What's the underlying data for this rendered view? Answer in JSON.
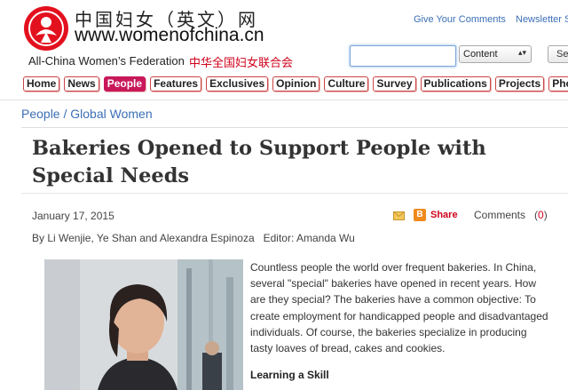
{
  "header": {
    "site_name_cn": "中国妇女（英文）网",
    "site_url": "www.womenofchina.cn",
    "federation_en": "All-China Women’s Federation",
    "federation_cn": "中华全国妇女联合会",
    "links": [
      "Give Your Comments",
      "Newsletter S"
    ]
  },
  "search": {
    "input_value": "",
    "select_value": "Content",
    "button_label": "Se"
  },
  "nav": {
    "items": [
      "Home",
      "News",
      "People",
      "Features",
      "Exclusives",
      "Opinion",
      "Culture",
      "Survey",
      "Publications",
      "Projects",
      "Pho"
    ],
    "active": "People"
  },
  "breadcrumb": "People / Global Women",
  "article": {
    "title": "Bakeries Opened to Support People with Special Needs",
    "date": "January 17, 2015",
    "share_label": "Share",
    "share_icon_glyph": "B",
    "comments_label": "Comments",
    "comments_open": "(",
    "comments_count": "0",
    "comments_close": ")",
    "byline": "By Li Wenjie, Ye Shan and Alexandra Espinoza   Editor: Amanda Wu",
    "body": "Countless people the world over frequent bakeries. In China, several \"special\" bakeries have opened in recent years. How are they special? The bakeries have a common objective: To create employment for handicapped people and disadvantaged individuals. Of course, the bakeries specialize in producing tasty loaves of bread, cakes and cookies.",
    "subhead": "Learning a Skill"
  },
  "icons": {
    "logo": "acwf-logo-icon",
    "mail": "mail-icon",
    "share": "share-icon",
    "select_arrow": "updown-arrow-icon"
  },
  "colors": {
    "brand_red": "#d0021b",
    "active_nav": "#c8185a",
    "link_blue": "#3b6fb6"
  }
}
